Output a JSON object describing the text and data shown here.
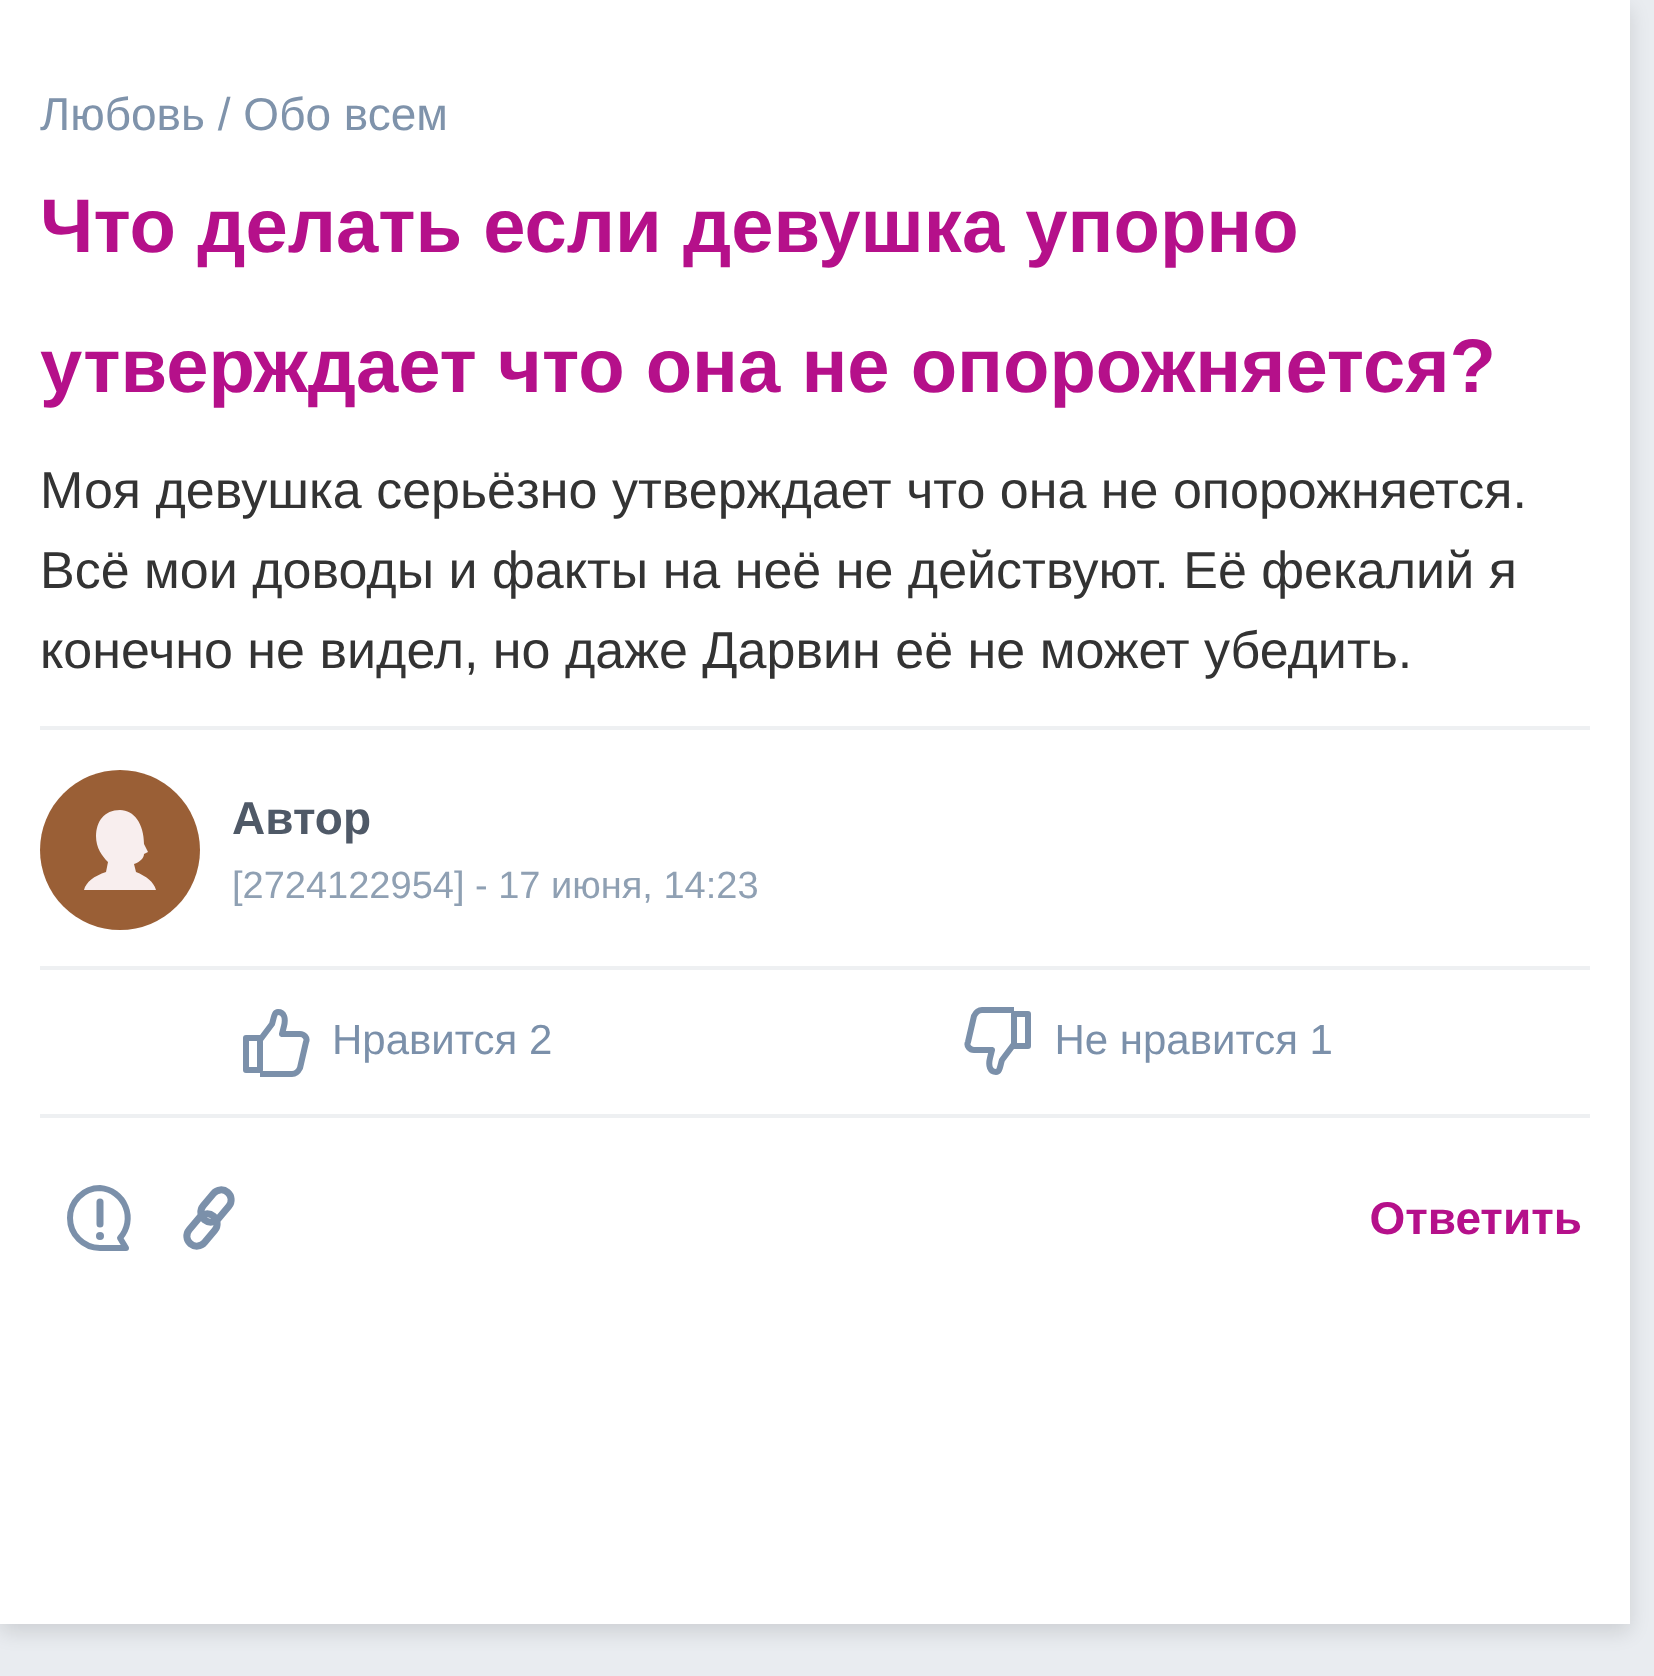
{
  "breadcrumb": "Любовь / Обо всем",
  "title": "Что делать если девушка упорно утверждает что она не опорожняется?",
  "body": "Моя девушка серьёзно утверждает что она не опорожняется. Всё мои доводы и факты на неё не действуют. Её фекалий я конечно не видел, но даже Дарвин её не может убедить.",
  "author": {
    "name": "Автор",
    "meta": "[2724122954] - 17 июня, 14:23"
  },
  "votes": [
    {
      "kind": "like",
      "label": "Нравится 2"
    },
    {
      "kind": "dislike",
      "label": "Не нравится 1"
    }
  ],
  "reply_button": "Ответить"
}
